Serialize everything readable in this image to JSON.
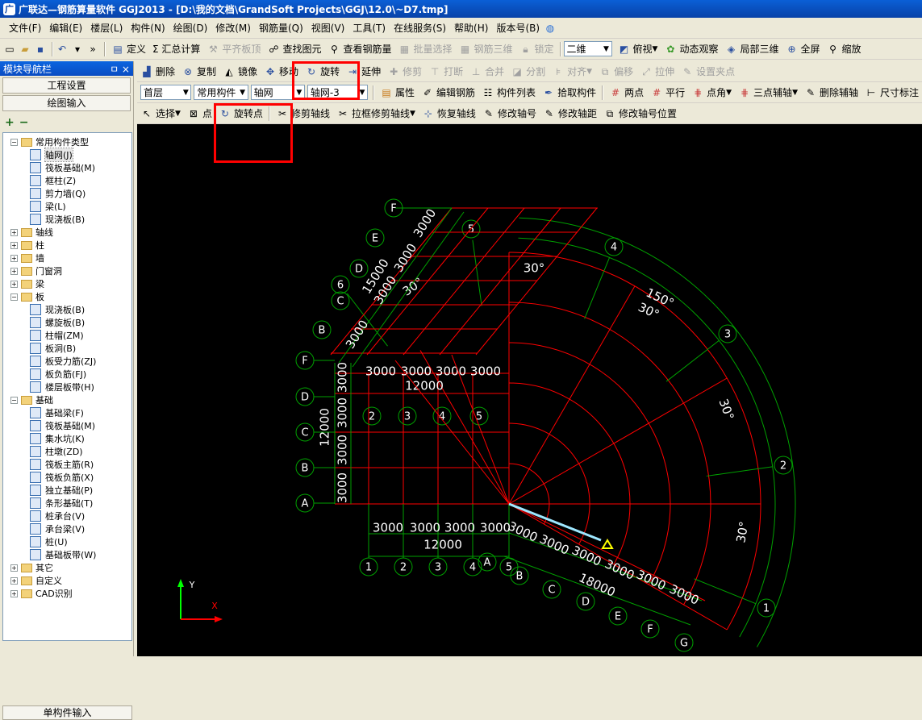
{
  "window": {
    "title": "广联达—钢筋算量软件 GGJ2013 - [D:\\我的文档\\GrandSoft Projects\\GGJ\\12.0\\~D7.tmp]"
  },
  "menu": [
    {
      "label": "文件(F)"
    },
    {
      "label": "编辑(E)"
    },
    {
      "label": "楼层(L)"
    },
    {
      "label": "构件(N)"
    },
    {
      "label": "绘图(D)"
    },
    {
      "label": "修改(M)"
    },
    {
      "label": "钢筋量(Q)"
    },
    {
      "label": "视图(V)"
    },
    {
      "label": "工具(T)"
    },
    {
      "label": "在线服务(S)"
    },
    {
      "label": "帮助(H)"
    },
    {
      "label": "版本号(B)"
    }
  ],
  "toolbar1": {
    "define": "定义",
    "sum": "Σ 汇总计算",
    "flatten": "平齐板顶",
    "find": "查找图元",
    "view_rebar": "查看钢筋量",
    "batch_select": "批量选择",
    "rebar3d": "钢筋三维",
    "lock": "锁定",
    "view2d": "二维",
    "topview": "俯视",
    "dynamic": "动态观察",
    "local3d": "局部三维",
    "fullscreen": "全屏",
    "zoomout": "缩放"
  },
  "toolbar2": {
    "delete": "删除",
    "copy": "复制",
    "mirror": "镜像",
    "move": "移动",
    "rotate": "旋转",
    "extend": "延伸",
    "trim": "修剪",
    "break": "打断",
    "merge": "合并",
    "split": "分割",
    "align": "对齐",
    "offset": "偏移",
    "stretch": "拉伸",
    "setpoint": "设置夹点"
  },
  "toolbar3": {
    "floor": "首层",
    "component_type": "常用构件",
    "component": "轴网",
    "instance": "轴网-3",
    "properties": "属性",
    "edit_rebar": "编辑钢筋",
    "component_list": "构件列表",
    "pick": "拾取构件",
    "two_points": "两点",
    "parallel": "平行",
    "point_angle": "点角",
    "three_points": "三点辅轴",
    "delete_aux": "删除辅轴",
    "dimension": "尺寸标注"
  },
  "toolbar4": {
    "select": "选择",
    "point": "点",
    "rotate_point": "旋转点",
    "trim_axis": "修剪轴线",
    "box_trim": "拉框修剪轴线",
    "restore_axis": "恢复轴线",
    "modify_axis_no": "修改轴号",
    "modify_spacing": "修改轴距",
    "modify_axis_pos": "修改轴号位置"
  },
  "leftpanel": {
    "title": "模块导航栏",
    "pin": "ㅁ ×",
    "project_settings": "工程设置",
    "draw_input": "绘图输入",
    "single_input": "单构件输入",
    "tree": [
      {
        "label": "常用构件类型",
        "level": 0,
        "folder": true,
        "open": true
      },
      {
        "label": "轴网(J)",
        "level": 1,
        "selected": true
      },
      {
        "label": "筏板基础(M)",
        "level": 1
      },
      {
        "label": "框柱(Z)",
        "level": 1
      },
      {
        "label": "剪力墙(Q)",
        "level": 1
      },
      {
        "label": "梁(L)",
        "level": 1
      },
      {
        "label": "现浇板(B)",
        "level": 1
      },
      {
        "label": "轴线",
        "level": 0,
        "folder": true
      },
      {
        "label": "柱",
        "level": 0,
        "folder": true
      },
      {
        "label": "墙",
        "level": 0,
        "folder": true
      },
      {
        "label": "门窗洞",
        "level": 0,
        "folder": true
      },
      {
        "label": "梁",
        "level": 0,
        "folder": true
      },
      {
        "label": "板",
        "level": 0,
        "folder": true,
        "open": true
      },
      {
        "label": "现浇板(B)",
        "level": 1
      },
      {
        "label": "螺旋板(B)",
        "level": 1
      },
      {
        "label": "柱帽(ZM)",
        "level": 1
      },
      {
        "label": "板洞(B)",
        "level": 1
      },
      {
        "label": "板受力筋(ZJ)",
        "level": 1
      },
      {
        "label": "板负筋(FJ)",
        "level": 1
      },
      {
        "label": "楼层板带(H)",
        "level": 1
      },
      {
        "label": "基础",
        "level": 0,
        "folder": true,
        "open": true
      },
      {
        "label": "基础梁(F)",
        "level": 1
      },
      {
        "label": "筏板基础(M)",
        "level": 1
      },
      {
        "label": "集水坑(K)",
        "level": 1
      },
      {
        "label": "柱墩(ZD)",
        "level": 1
      },
      {
        "label": "筏板主筋(R)",
        "level": 1
      },
      {
        "label": "筏板负筋(X)",
        "level": 1
      },
      {
        "label": "独立基础(P)",
        "level": 1
      },
      {
        "label": "条形基础(T)",
        "level": 1
      },
      {
        "label": "桩承台(V)",
        "level": 1
      },
      {
        "label": "承台梁(V)",
        "level": 1
      },
      {
        "label": "桩(U)",
        "level": 1
      },
      {
        "label": "基础板带(W)",
        "level": 1
      },
      {
        "label": "其它",
        "level": 0,
        "folder": true
      },
      {
        "label": "自定义",
        "level": 0,
        "folder": true
      },
      {
        "label": "CAD识别",
        "level": 0,
        "folder": true
      }
    ]
  },
  "canvas": {
    "grid_colors": {
      "axis": "#00a000",
      "red": "#ff0000",
      "white": "#ffffff",
      "highlight": "#9ee7ff",
      "marker": "#ffff00"
    },
    "rect_grid": {
      "x_labels": [
        "1",
        "2",
        "3",
        "4",
        "5"
      ],
      "y_labels": [
        "A",
        "B",
        "C",
        "D",
        "F"
      ],
      "x_dims": [
        "3000",
        "3000",
        "3000",
        "3000"
      ],
      "x_total": "12000",
      "y_dims": [
        "3000",
        "3000",
        "3000",
        "3000"
      ],
      "y_total": "12000",
      "inner_x_labels": [
        "2",
        "3",
        "4",
        "5"
      ]
    },
    "top_grid": {
      "dims": [
        "3000",
        "3000",
        "3000",
        "3000"
      ],
      "total": "12000"
    },
    "arc_grid": {
      "labels": [
        "1",
        "2",
        "3",
        "4",
        "5",
        "6"
      ],
      "angles": [
        "30°",
        "30°",
        "150°",
        "30°",
        "30°",
        "30°"
      ]
    },
    "skew_grid": {
      "labels": [
        "A",
        "B",
        "C",
        "D",
        "E",
        "F",
        "G"
      ],
      "dims": [
        "3000",
        "3000",
        "3000",
        "3000",
        "3000",
        "3000"
      ],
      "total": "18000"
    },
    "upper_skew": {
      "labels": [
        "B",
        "C",
        "D",
        "E",
        "F"
      ],
      "dims": [
        "3000",
        "3000",
        "3000",
        "3000"
      ],
      "total": "15000"
    },
    "ucs": {
      "x": "X",
      "y": "Y"
    }
  }
}
